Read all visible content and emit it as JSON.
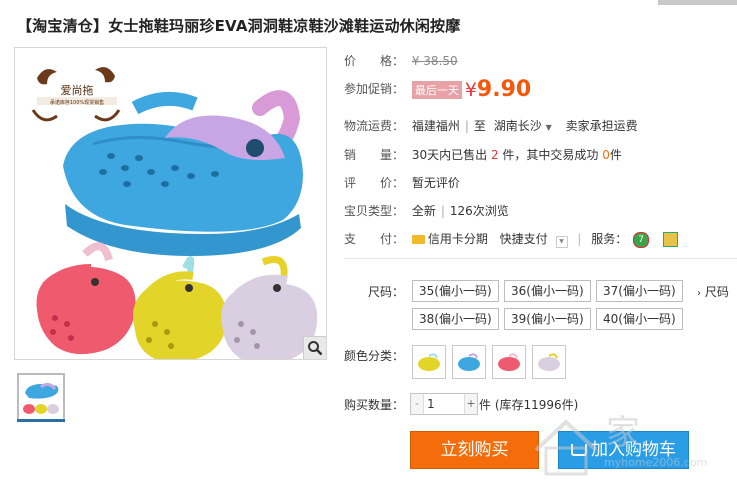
{
  "title": "【淘宝清仓】女士拖鞋玛丽珍EVA洞洞鞋凉鞋沙滩鞋运动休闲按摩",
  "brand_logo": {
    "name": "爱尚拖",
    "tagline": "承诺库存100%现货销售"
  },
  "price": {
    "label": "价　　格：",
    "currency": "¥",
    "original": "38.50"
  },
  "promotion": {
    "label": "参加促销：",
    "tag": "最后一天",
    "currency": "¥",
    "price": "9.90"
  },
  "shipping": {
    "label": "物流运费：",
    "from": "福建福州",
    "to_prefix": "至",
    "to": "湖南长沙",
    "fee": "卖家承担运费"
  },
  "sales": {
    "label": "销　　量：",
    "prefix": "30天内已售出",
    "sold": "2",
    "middle": "件，其中交易成功",
    "success": "0",
    "unit": "件"
  },
  "review": {
    "label": "评　　价：",
    "value": "暂无评价"
  },
  "item_type": {
    "label": "宝贝类型：",
    "condition": "全新",
    "views": "126次浏览"
  },
  "payment": {
    "label": "支　　付：",
    "credit": "信用卡分期",
    "quick": "快捷支付",
    "service_label": "服务："
  },
  "size": {
    "label": "尺码：",
    "options": [
      "35(偏小一码)",
      "36(偏小一码)",
      "37(偏小一码)",
      "38(偏小一码)",
      "39(偏小一码)",
      "40(偏小一码)"
    ],
    "table_link": "尺码"
  },
  "color": {
    "label": "颜色分类："
  },
  "quantity": {
    "label": "购买数量：",
    "value": "1",
    "stock": "件 (库存11996件)"
  },
  "buttons": {
    "buy": "立刻购买",
    "cart": "加入购物车"
  },
  "watermark": {
    "text": "家",
    "url": "myhome2006.com"
  },
  "colors": {
    "accent": "#f46d0a",
    "price_red": "#e4393c",
    "cart_blue": "#2a9de7",
    "shoe_blue": "#3fa7e0",
    "shoe_purple": "#c8a6e6"
  }
}
